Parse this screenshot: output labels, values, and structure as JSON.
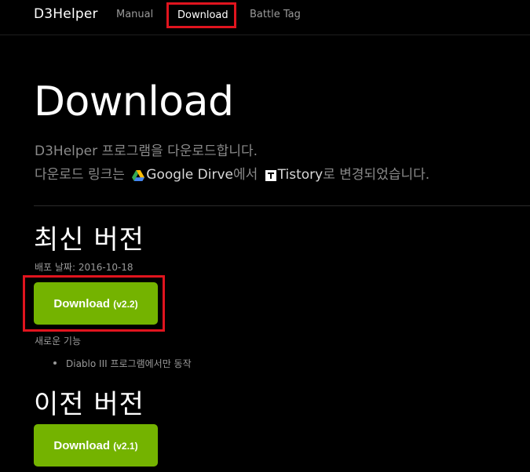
{
  "navbar": {
    "brand": "D3Helper",
    "links": [
      {
        "label": "Manual"
      },
      {
        "label": "Download",
        "active": true
      },
      {
        "label": "Battle Tag"
      }
    ]
  },
  "hero": {
    "title": "Download",
    "line1": "D3Helper 프로그램을 다운로드합니다.",
    "line2_prefix": "다운로드 링크는",
    "line2_google": "Google Dirve",
    "line2_mid": "에서",
    "line2_tistory": "Tistory",
    "line2_suffix": "로 변경되었습니다."
  },
  "latest": {
    "title": "최신 버전",
    "date_label": "배포 날짜: 2016-10-18",
    "button_label": "Download",
    "button_version": "(v2.2)",
    "features_label": "새로운 기능",
    "features": [
      "Diablo III 프로그램에서만 동작"
    ]
  },
  "previous": {
    "title": "이전 버전",
    "button_label": "Download",
    "button_version": "(v2.1)"
  },
  "colors": {
    "background": "#000000",
    "button": "#74b300",
    "highlight_border": "#e0141e",
    "muted_text": "#8a8a8a"
  },
  "icons": {
    "google_drive": "google-drive-icon",
    "tistory": "tistory-icon"
  }
}
